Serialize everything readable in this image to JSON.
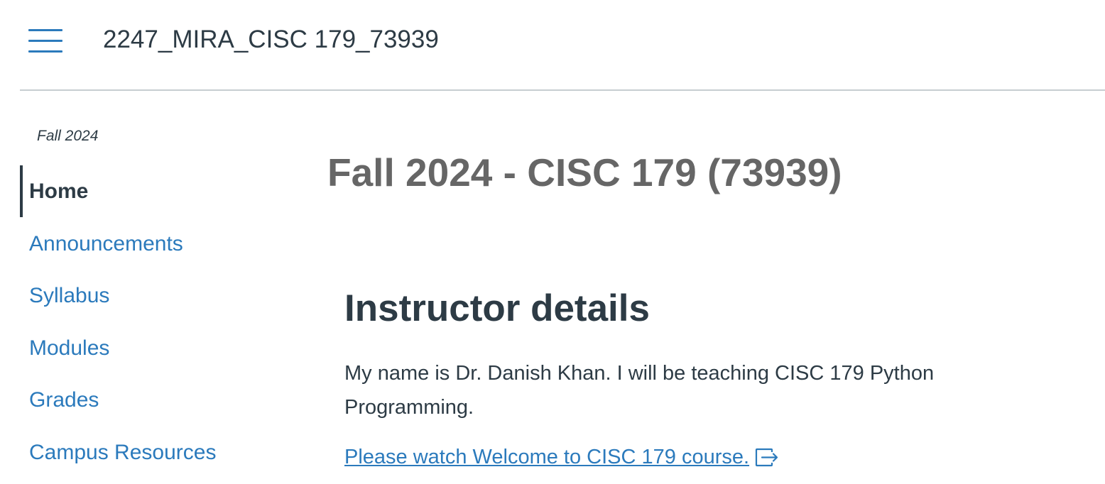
{
  "header": {
    "course_code": "2247_MIRA_CISC 179_73939",
    "menu_icon": "hamburger-menu-icon"
  },
  "sidebar": {
    "term": "Fall 2024",
    "items": [
      {
        "label": "Home",
        "active": true
      },
      {
        "label": "Announcements",
        "active": false
      },
      {
        "label": "Syllabus",
        "active": false
      },
      {
        "label": "Modules",
        "active": false
      },
      {
        "label": "Grades",
        "active": false
      },
      {
        "label": "Campus Resources",
        "active": false
      }
    ]
  },
  "main": {
    "title": "Fall 2024 - CISC 179 (73939)",
    "section_heading": "Instructor details",
    "intro_text": "My name is Dr. Danish Khan. I will be teaching CISC 179 Python Programming.",
    "welcome_link": "Please watch Welcome to CISC 179 course.",
    "welcome_link_icon": "external-link-icon"
  },
  "colors": {
    "link": "#2b7abc",
    "text": "#2d3b45",
    "title": "#666666",
    "divider": "#c7cdd1"
  }
}
